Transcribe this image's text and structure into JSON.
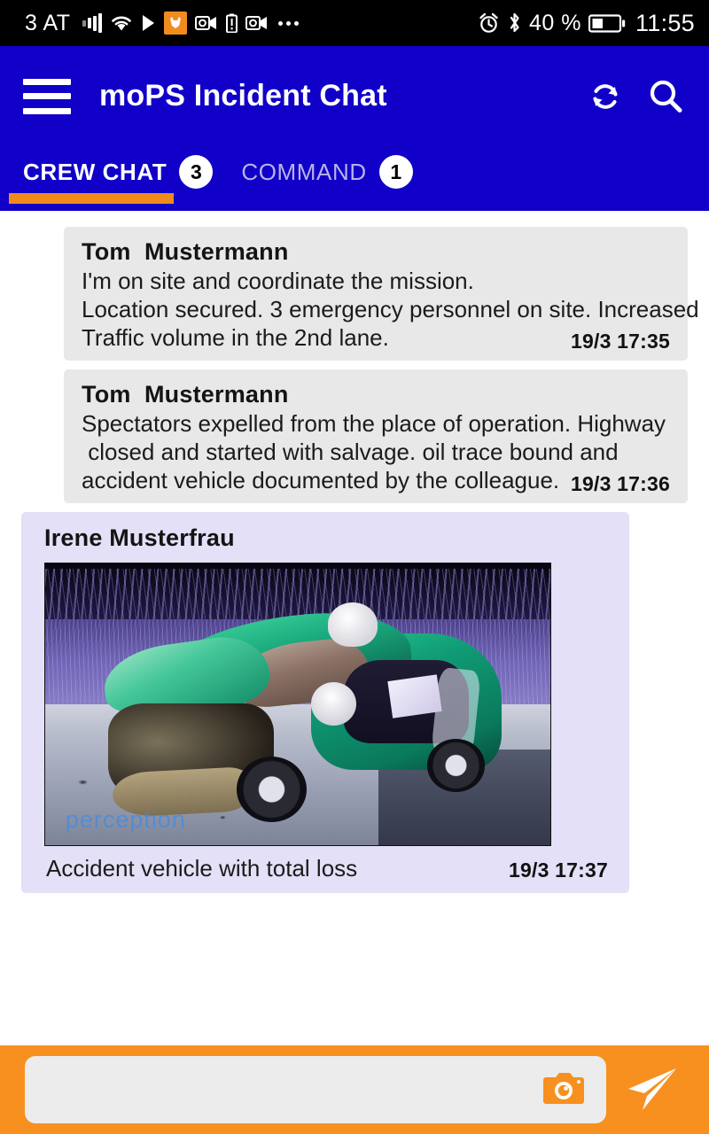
{
  "status_bar": {
    "carrier": "3 AT",
    "icons_left": [
      "signal-bars-icon",
      "wifi-icon",
      "play-icon",
      "app-orange-icon",
      "outlook-video-icon",
      "battery-alert-icon",
      "outlook-video-icon-2",
      "more-dots-icon"
    ],
    "alarm_icon": "alarm-clock-icon",
    "bluetooth_icon": "bluetooth-icon",
    "battery_percent": "40 %",
    "battery_icon": "battery-icon",
    "battery_level": 40,
    "time": "11:55"
  },
  "app_bar": {
    "menu_icon": "hamburger-menu-icon",
    "title": "moPS Incident Chat",
    "refresh_icon": "refresh-icon",
    "search_icon": "search-icon"
  },
  "tabs": [
    {
      "label": "CREW CHAT",
      "badge": "3",
      "active": true
    },
    {
      "label": "COMMAND",
      "badge": "1",
      "active": false
    }
  ],
  "messages": [
    {
      "sender": "Tom  Mustermann",
      "lines": [
        "I'm on site and coordinate the mission.",
        "Location secured. 3 emergency personnel on site. Increased",
        "Traffic volume in the 2nd lane."
      ],
      "timestamp": "19/3 17:35",
      "type": "text"
    },
    {
      "sender": "Tom  Mustermann",
      "lines": [
        "Spectators expelled from the place of operation. Highway",
        " closed and started with salvage. oil trace bound and",
        "accident vehicle documented by the colleague."
      ],
      "timestamp": "19/3 17:36",
      "type": "text"
    },
    {
      "sender": "Irene Musterfrau",
      "caption": "Accident vehicle with total loss",
      "timestamp": "19/3 17:37",
      "type": "image",
      "image_alt": "Accident vehicle with total loss",
      "image_watermark": "perception"
    }
  ],
  "composer": {
    "input_value": "",
    "input_placeholder": "",
    "camera_icon": "camera-icon",
    "send_icon": "send-paper-plane-icon"
  },
  "colors": {
    "app_bar_blue": "#1000c8",
    "accent_orange": "#f7901e",
    "tab_indicator_orange": "#f08a1c",
    "bubble_gray": "#e8e8e8",
    "bubble_lavender": "#e3e0f7",
    "status_bar_black": "#000000"
  }
}
